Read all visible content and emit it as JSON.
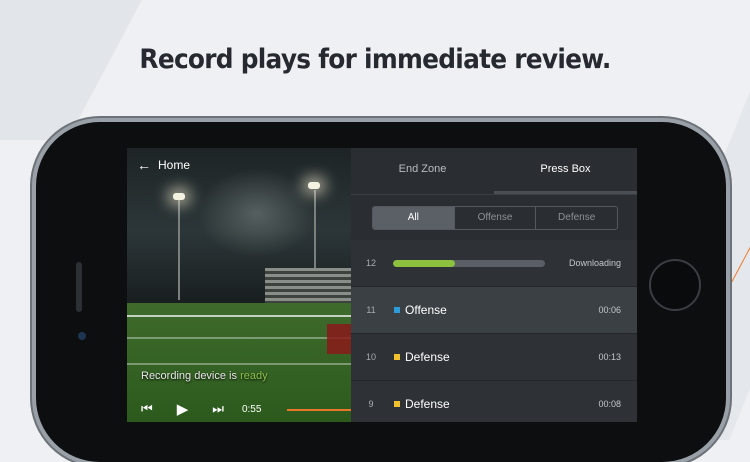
{
  "headline": "Record plays for immediate review.",
  "video": {
    "home_label": "Home",
    "recording_prefix": "Recording device is ",
    "recording_status": "ready",
    "time": "0:55"
  },
  "panel": {
    "tabs": [
      {
        "label": "End Zone",
        "active": false
      },
      {
        "label": "Press Box",
        "active": true
      }
    ],
    "filters": [
      {
        "label": "All",
        "active": true
      },
      {
        "label": "Offense",
        "active": false
      },
      {
        "label": "Defense",
        "active": false
      }
    ],
    "plays": [
      {
        "number": "12",
        "status": "Downloading",
        "progress": 0.41
      },
      {
        "number": "11",
        "label": "Offense",
        "time": "00:06",
        "color": "#2d9cdb",
        "selected": true
      },
      {
        "number": "10",
        "label": "Defense",
        "time": "00:13",
        "color": "#f2c12e"
      },
      {
        "number": "9",
        "label": "Defense",
        "time": "00:08",
        "color": "#f2c12e"
      }
    ]
  },
  "colors": {
    "ready": "#8bc34a",
    "progress": "#8dc03f",
    "scrubber": "#e8762b"
  }
}
